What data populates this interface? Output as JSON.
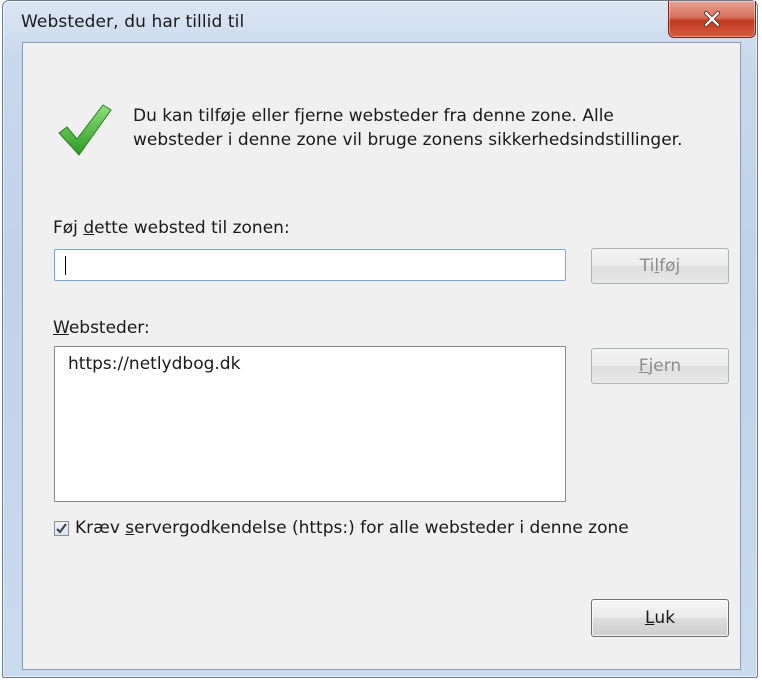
{
  "window": {
    "title": "Websteder, du har tillid til",
    "close_icon": "close-x-icon"
  },
  "info": {
    "icon": "checkmark-icon",
    "icon_color": "#3fae32",
    "text": "Du kan tilføje eller fjerne websteder fra denne zone. Alle\nwebsteder i denne zone vil bruge zonens sikkerhedsindstillinger."
  },
  "add_site": {
    "label_before": "Føj ",
    "label_mnemonic": "d",
    "label_after": "ette websted til zonen:",
    "input_value": "",
    "button_before": "Ti",
    "button_mnemonic": "l",
    "button_after": "føj"
  },
  "sites": {
    "label_mnemonic": "W",
    "label_after": "ebsteder:",
    "items": [
      "https://netlydbog.dk"
    ],
    "remove_mnemonic": "F",
    "remove_after": "jern"
  },
  "https_checkbox": {
    "checked": true,
    "label_before": "Kræv ",
    "label_mnemonic": "s",
    "label_after": "ervergodkendelse (https:) for alle websteder i denne zone"
  },
  "footer": {
    "close_mnemonic": "L",
    "close_after": "uk"
  }
}
